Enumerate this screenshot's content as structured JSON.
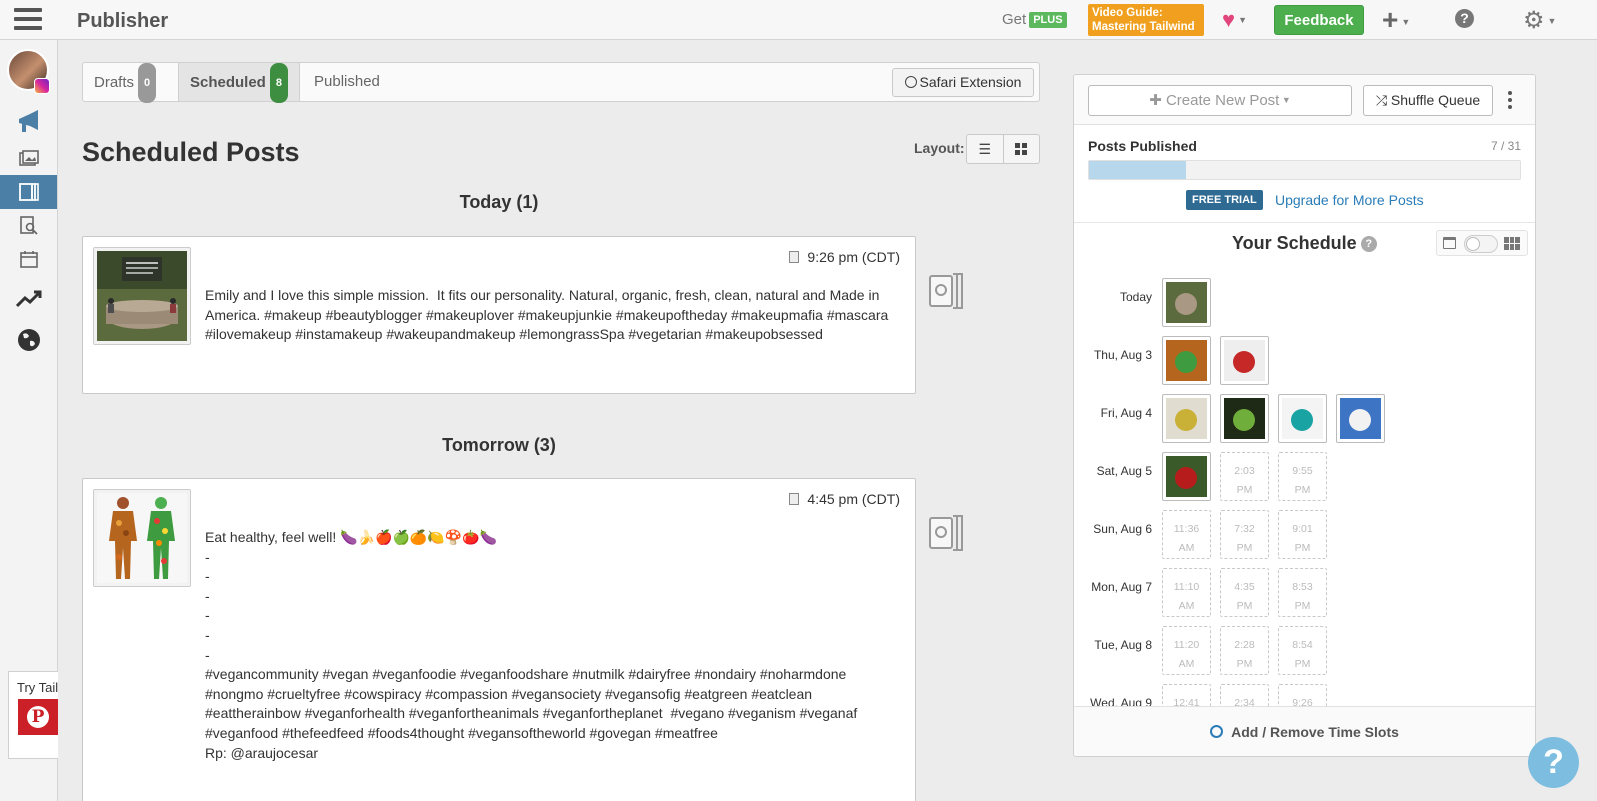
{
  "topbar": {
    "title": "Publisher",
    "get_label": "Get",
    "plus_badge": "PLUS",
    "video_guide_line1": "Video Guide:",
    "video_guide_line2": "Mastering Tailwind",
    "feedback_label": "Feedback"
  },
  "tabs": [
    {
      "label": "Drafts",
      "count": "0"
    },
    {
      "label": "Scheduled",
      "count": "8"
    },
    {
      "label": "Published"
    }
  ],
  "safari_extension_label": "Safari Extension",
  "page_title": "Scheduled Posts",
  "layout_label": "Layout:",
  "sidebar": {
    "try_text": "Try Tail"
  },
  "groups": [
    {
      "heading": "Today (1)",
      "posts": [
        {
          "time": "9:26 pm (CDT)",
          "text": "Emily and I love this simple mission.  It fits our personality. Natural, organic, fresh, clean, natural and Made in America. #makeup #beautyblogger #makeuplover #makeupjunkie #makeupoftheday #makeupmafia #mascara #ilovemakeup #instamakeup #wakeupandmakeup #lemongrassSpa #vegetarian #makeupobsessed"
        }
      ]
    },
    {
      "heading": "Tomorrow (3)",
      "posts": [
        {
          "time": "4:45 pm (CDT)",
          "text": "Eat healthy, feel well! 🍆🍌🍎🍏🍊🍋🍄🍅🍆\n-\n-\n-\n-\n-\n-\n#vegancommunity #vegan #veganfoodie #veganfoodshare #nutmilk #dairyfree #nondairy #noharmdone #nongmo #crueltyfree #cowspiracy #compassion #vegansociety #vegansofig #eatgreen #eatclean #eattherainbow #veganforhealth #veganfortheanimals #veganfortheplanet  #vegano #veganism #veganaf #veganfood #thefeedfeed #foods4thought #vegansoftheworld #govegan #meatfree\nRp: @araujocesar"
        }
      ]
    }
  ],
  "right_panel": {
    "create_label": "Create New Post",
    "shuffle_label": "Shuffle Queue",
    "posts_published_label": "Posts Published",
    "posts_published_count": "7 / 31",
    "progress_fraction": 0.226,
    "free_trial_label": "FREE TRIAL",
    "upgrade_label": "Upgrade for More Posts",
    "schedule_title": "Your Schedule",
    "add_remove_label": "Add / Remove Time Slots"
  },
  "schedule": [
    {
      "day": "Today",
      "slots": [
        {
          "filled": true
        }
      ]
    },
    {
      "day": "Thu, Aug 3",
      "slots": [
        {
          "filled": true
        },
        {
          "filled": true
        }
      ]
    },
    {
      "day": "Fri, Aug 4",
      "slots": [
        {
          "filled": true
        },
        {
          "filled": true
        },
        {
          "filled": true
        },
        {
          "filled": true
        }
      ]
    },
    {
      "day": "Sat, Aug 5",
      "slots": [
        {
          "filled": true
        },
        {
          "time": "2:03",
          "ampm": "PM"
        },
        {
          "time": "9:55",
          "ampm": "PM"
        }
      ]
    },
    {
      "day": "Sun, Aug 6",
      "slots": [
        {
          "time": "11:36",
          "ampm": "AM"
        },
        {
          "time": "7:32",
          "ampm": "PM"
        },
        {
          "time": "9:01",
          "ampm": "PM"
        }
      ]
    },
    {
      "day": "Mon, Aug 7",
      "slots": [
        {
          "time": "11:10",
          "ampm": "AM"
        },
        {
          "time": "4:35",
          "ampm": "PM"
        },
        {
          "time": "8:53",
          "ampm": "PM"
        }
      ]
    },
    {
      "day": "Tue, Aug 8",
      "slots": [
        {
          "time": "11:20",
          "ampm": "AM"
        },
        {
          "time": "2:28",
          "ampm": "PM"
        },
        {
          "time": "8:54",
          "ampm": "PM"
        }
      ]
    },
    {
      "day": "Wed, Aug 9",
      "slots": [
        {
          "time": "12:41",
          "ampm": ""
        },
        {
          "time": "2:34",
          "ampm": ""
        },
        {
          "time": "9:26",
          "ampm": ""
        }
      ]
    }
  ],
  "colors": {
    "accent_blue": "#4c7fa6",
    "feedback_green": "#4cae4c",
    "video_orange": "#f0a01e",
    "heart_pink": "#e0457b",
    "trial_blue": "#2f6a93",
    "link_blue": "#2a7cb7"
  },
  "icons": [
    "hamburger-icon",
    "heart-icon",
    "plus-icon",
    "help-icon",
    "gear-icon",
    "megaphone-icon",
    "images-icon",
    "publisher-icon",
    "search-pins-icon",
    "calendar-icon",
    "analytics-icon",
    "globe-icon",
    "pinterest-icon",
    "instagram-icon",
    "compass-icon",
    "list-view-icon",
    "grid-view-icon",
    "shuffle-icon",
    "alarm-icon"
  ]
}
